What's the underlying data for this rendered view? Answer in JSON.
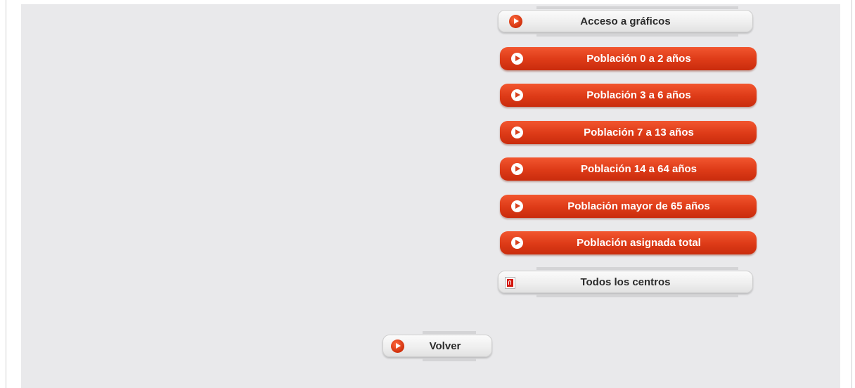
{
  "buttons": {
    "charts_access": {
      "label": "Acceso a gráficos",
      "icon": "play-circle-icon"
    },
    "population_items": [
      {
        "label": "Población 0 a 2 años",
        "icon": "play-circle-icon"
      },
      {
        "label": "Población 3 a 6 años",
        "icon": "play-circle-icon"
      },
      {
        "label": "Población 7 a 13 años",
        "icon": "play-circle-icon"
      },
      {
        "label": "Población 14 a 64 años",
        "icon": "play-circle-icon"
      },
      {
        "label": "Población mayor de 65 años",
        "icon": "play-circle-icon"
      },
      {
        "label": "Población asignada total",
        "icon": "play-circle-icon"
      }
    ],
    "all_centers": {
      "label": "Todos los centros",
      "icon": "pdf-icon"
    },
    "back": {
      "label": "Volver",
      "icon": "play-circle-icon"
    }
  },
  "colors": {
    "panel_background": "#e9e9eb",
    "accent_orange": "#dd3a17",
    "button_grey": "#efefef",
    "icon_red": "#d0300c"
  }
}
